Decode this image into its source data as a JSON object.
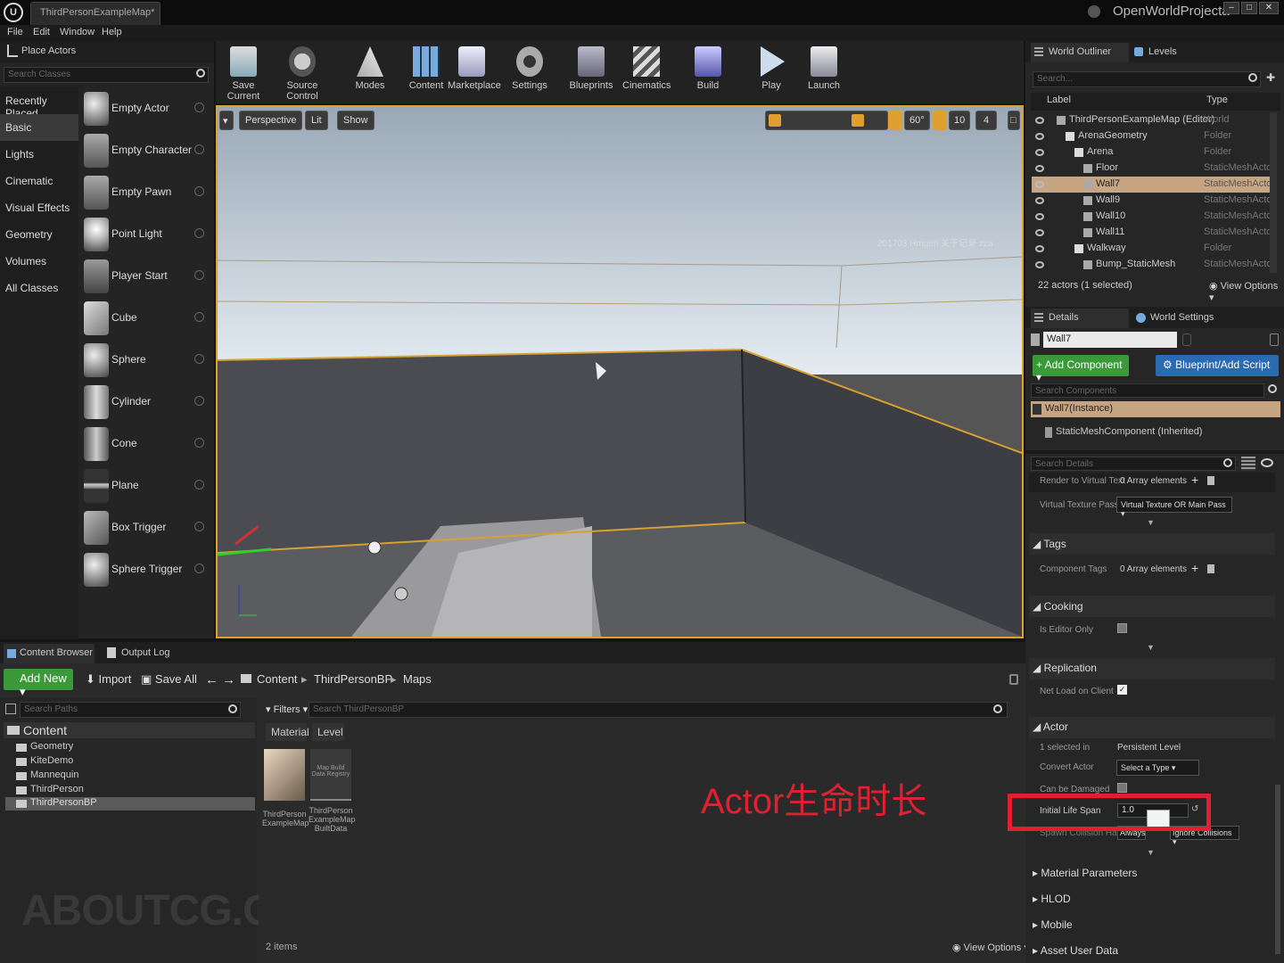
{
  "window": {
    "doc_tab": "ThirdPersonExampleMap*",
    "project_name": "OpenWorldProjecta",
    "logo": "U"
  },
  "menu": [
    "File",
    "Edit",
    "Window",
    "Help"
  ],
  "place_actors": {
    "title": "Place Actors",
    "search_placeholder": "Search Classes",
    "categories": [
      "Recently Placed",
      "Basic",
      "Lights",
      "Cinematic",
      "Visual Effects",
      "Geometry",
      "Volumes",
      "All Classes"
    ],
    "actors": [
      "Empty Actor",
      "Empty Character",
      "Empty Pawn",
      "Point Light",
      "Player Start",
      "Cube",
      "Sphere",
      "Cylinder",
      "Cone",
      "Plane",
      "Box Trigger",
      "Sphere Trigger"
    ]
  },
  "toolbar": {
    "buttons": [
      {
        "label": "Save Current",
        "icon": "save-icon"
      },
      {
        "label": "Source Control",
        "icon": "source-control-icon"
      },
      {
        "label": "Modes",
        "icon": "modes-icon"
      },
      {
        "label": "Content",
        "icon": "content-icon"
      },
      {
        "label": "Marketplace",
        "icon": "marketplace-icon"
      },
      {
        "label": "Settings",
        "icon": "settings-icon"
      },
      {
        "label": "Blueprints",
        "icon": "blueprints-icon"
      },
      {
        "label": "Cinematics",
        "icon": "cinematics-icon"
      },
      {
        "label": "Build",
        "icon": "build-icon"
      },
      {
        "label": "Play",
        "icon": "play-icon"
      },
      {
        "label": "Launch",
        "icon": "launch-icon"
      }
    ]
  },
  "viewport": {
    "perspective": "Perspective",
    "lit": "Lit",
    "show": "Show",
    "fov": "60°",
    "snap": "10",
    "speed": "4",
    "watermark": "201703 Hmueh 关于记录 zza"
  },
  "content_browser": {
    "tabs": [
      "Content Browser",
      "Output Log"
    ],
    "add_new": "Add New",
    "import": "Import",
    "save_all": "Save All",
    "breadcrumb": [
      "Content",
      "ThirdPersonBP",
      "Maps"
    ],
    "search_paths": "Search Paths",
    "filters": "Filters",
    "search_assets": "Search ThirdPersonBP",
    "filter_chips": [
      "Material",
      "Level"
    ],
    "tree_root": "Content",
    "tree": [
      "Geometry",
      "KiteDemo",
      "Mannequin",
      "ThirdPerson",
      "ThirdPersonBP"
    ],
    "assets": [
      {
        "name": "ThirdPerson ExampleMap"
      },
      {
        "name": "ThirdPerson ExampleMap BuiltData",
        "thumb_text": "Map Build Data Registry"
      }
    ],
    "item_count": "2 items",
    "view_options": "View Options",
    "overlay_caption": "Actor生命时长",
    "bottom_watermark": "ABOUTCG.ORG"
  },
  "outliner": {
    "tabs": [
      "World Outliner",
      "Levels"
    ],
    "search_placeholder": "Search...",
    "col_label": "Label",
    "col_type": "Type",
    "rows": [
      {
        "label": "ThirdPersonExampleMap (Editor)",
        "type": "World",
        "indent": 0
      },
      {
        "label": "ArenaGeometry",
        "type": "Folder",
        "indent": 1
      },
      {
        "label": "Arena",
        "type": "Folder",
        "indent": 2
      },
      {
        "label": "Floor",
        "type": "StaticMeshActor",
        "indent": 3
      },
      {
        "label": "Wall7",
        "type": "StaticMeshActor",
        "indent": 3,
        "selected": true
      },
      {
        "label": "Wall9",
        "type": "StaticMeshActor",
        "indent": 3
      },
      {
        "label": "Wall10",
        "type": "StaticMeshActor",
        "indent": 3
      },
      {
        "label": "Wall11",
        "type": "StaticMeshActor",
        "indent": 3
      },
      {
        "label": "Walkway",
        "type": "Folder",
        "indent": 2
      },
      {
        "label": "Bump_StaticMesh",
        "type": "StaticMeshActor",
        "indent": 3
      }
    ],
    "summary": "22 actors (1 selected)",
    "view_options": "View Options"
  },
  "details": {
    "tabs": [
      "Details",
      "World Settings"
    ],
    "name_value": "Wall7",
    "add_component": "+ Add Component",
    "blueprint_button": "Blueprint/Add Script",
    "search_components": "Search Components",
    "instance_row": "Wall7(Instance)",
    "component_row": "StaticMeshComponent (Inherited)",
    "search_details": "Search Details",
    "props": {
      "render_vt_label": "Render to Virtual Text",
      "render_vt_value": "0 Array elements",
      "vt_pass_label": "Virtual Texture Pass T",
      "vt_pass_value": "Virtual Texture OR Main Pass",
      "tags_section": "Tags",
      "component_tags_label": "Component Tags",
      "component_tags_value": "0 Array elements",
      "cooking_section": "Cooking",
      "editor_only_label": "Is Editor Only",
      "replication_section": "Replication",
      "net_load_label": "Net Load on Client",
      "actor_section": "Actor",
      "selected_in_label": "1 selected in",
      "selected_in_value": "Persistent Level",
      "convert_label": "Convert Actor",
      "convert_value": "Select a Type",
      "can_damaged_label": "Can be Damaged",
      "life_span_label": "Initial Life Span",
      "life_span_value": "1.0",
      "spawn_label": "Spawn Collision Hand",
      "spawn_value_a": "Always",
      "spawn_value_b": "Ignore Collisions",
      "material_params": "Material Parameters",
      "hlod": "HLOD",
      "mobile": "Mobile",
      "asset_user_data": "Asset User Data"
    }
  },
  "colors": {
    "selection_orange": "#e0a030",
    "add_green": "#3a9a3a",
    "blueprint_blue": "#2a6ab0",
    "highlight_red": "#e02030",
    "caption_red": "#e02030"
  }
}
